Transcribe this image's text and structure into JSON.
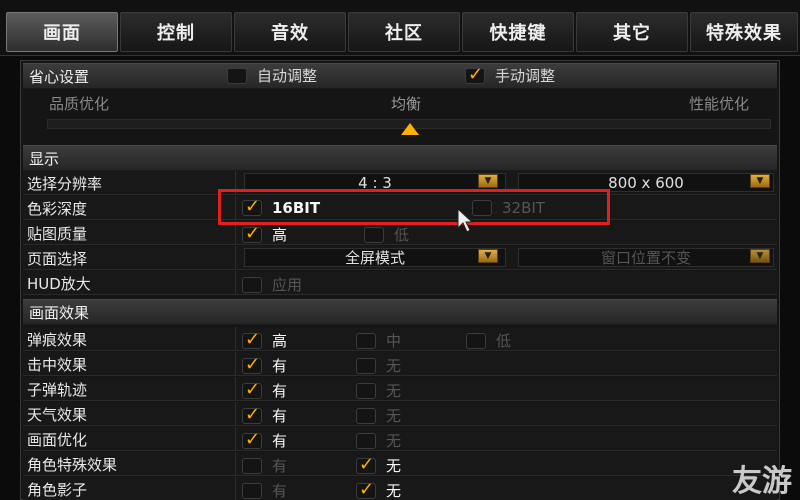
{
  "tabs": [
    "画面",
    "控制",
    "音效",
    "社区",
    "快捷键",
    "其它",
    "特殊效果"
  ],
  "easy": {
    "title": "省心设置",
    "auto_label": "自动调整",
    "manual_label": "手动调整",
    "left_label": "品质优化",
    "mid_label": "均衡",
    "right_label": "性能优化"
  },
  "display": {
    "title": "显示",
    "resolution_label": "选择分辨率",
    "ratio_value": "4 : 3",
    "res_value": "800 x 600",
    "color_depth_label": "色彩深度",
    "bit16": "16BIT",
    "bit32": "32BIT",
    "texture_label": "贴图质量",
    "high": "高",
    "low": "低",
    "page_label": "页面选择",
    "page_value": "全屏模式",
    "window_value": "窗口位置不变",
    "hud_label": "HUD放大",
    "apply": "应用"
  },
  "effects": {
    "title": "画面效果",
    "rows": [
      {
        "label": "弹痕效果",
        "opts": [
          "高",
          "中",
          "低"
        ]
      },
      {
        "label": "击中效果",
        "opts": [
          "有",
          "无"
        ]
      },
      {
        "label": "子弹轨迹",
        "opts": [
          "有",
          "无"
        ]
      },
      {
        "label": "天气效果",
        "opts": [
          "有",
          "无"
        ]
      },
      {
        "label": "画面优化",
        "opts": [
          "有",
          "无"
        ]
      },
      {
        "label": "角色特殊效果",
        "opts": [
          "有",
          "无"
        ]
      },
      {
        "label": "角色影子",
        "opts": [
          "有",
          "无"
        ]
      }
    ]
  },
  "watermark": "友游",
  "colors": {
    "accent": "#ffb000",
    "highlight": "#e02020"
  }
}
